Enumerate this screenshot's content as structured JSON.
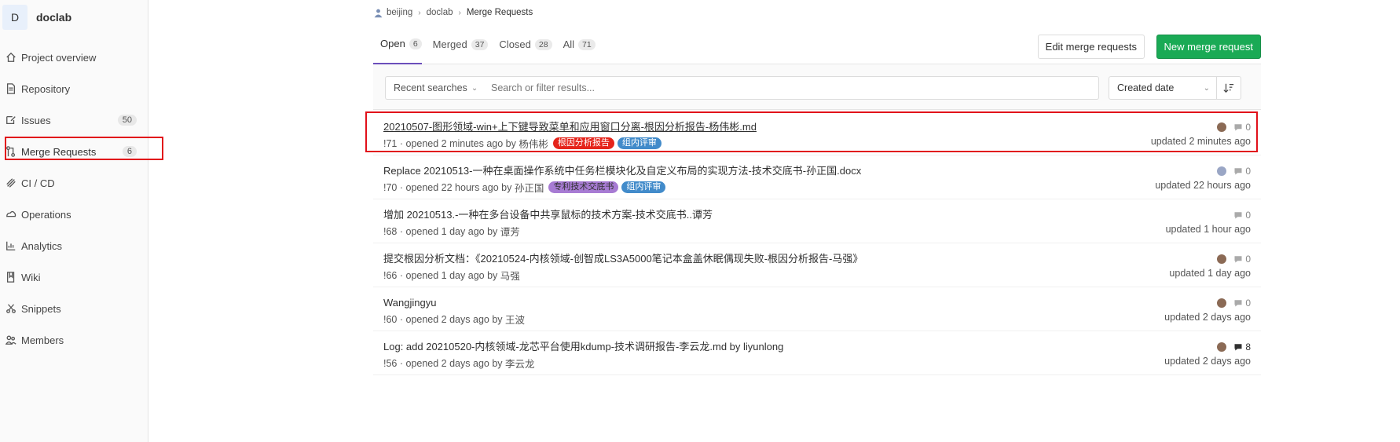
{
  "sidebar": {
    "project_initial": "D",
    "project_name": "doclab",
    "items": [
      {
        "label": "Project overview",
        "icon": "home-icon"
      },
      {
        "label": "Repository",
        "icon": "doc-icon"
      },
      {
        "label": "Issues",
        "icon": "issues-icon",
        "count": "50"
      },
      {
        "label": "Merge Requests",
        "icon": "merge-icon",
        "count": "6"
      },
      {
        "label": "CI / CD",
        "icon": "rocket-icon"
      },
      {
        "label": "Operations",
        "icon": "cloud-icon"
      },
      {
        "label": "Analytics",
        "icon": "chart-icon"
      },
      {
        "label": "Wiki",
        "icon": "book-icon"
      },
      {
        "label": "Snippets",
        "icon": "scissors-icon"
      },
      {
        "label": "Members",
        "icon": "users-icon"
      }
    ]
  },
  "breadcrumb": {
    "group": "beijing",
    "project": "doclab",
    "current": "Merge Requests"
  },
  "tabs": [
    {
      "label": "Open",
      "count": "6"
    },
    {
      "label": "Merged",
      "count": "37"
    },
    {
      "label": "Closed",
      "count": "28"
    },
    {
      "label": "All",
      "count": "71"
    }
  ],
  "actions": {
    "edit": "Edit merge requests",
    "new": "New merge request"
  },
  "filter": {
    "recent": "Recent searches",
    "placeholder": "Search or filter results...",
    "sort": "Created date"
  },
  "colors": {
    "accent": "#6b4fbb",
    "new_button": "#1aaa55",
    "highlight": "#e1101a"
  },
  "merge_requests": [
    {
      "title": "20210507-图形领域-win+上下键导致菜单和应用窗口分离-根因分析报告-杨伟彬.md",
      "ref": "!71",
      "opened": "opened 2 minutes ago by",
      "author": "杨伟彬",
      "labels": [
        {
          "text": "根因分析报告",
          "color": "#e5241b"
        },
        {
          "text": "组内评审",
          "color": "#428bca"
        }
      ],
      "comments": "0",
      "updated": "updated 2 minutes ago"
    },
    {
      "title": "Replace 20210513-一种在桌面操作系统中任务栏模块化及自定义布局的实现方法-技术交底书-孙正国.docx",
      "ref": "!70",
      "opened": "opened 22 hours ago by",
      "author": "孙正国",
      "labels": [
        {
          "text": "专利技术交底书",
          "color": "#a77bd3"
        },
        {
          "text": "组内评审",
          "color": "#428bca"
        }
      ],
      "comments": "0",
      "updated": "updated 22 hours ago"
    },
    {
      "title": "增加 20210513.-一种在多台设备中共享鼠标的技术方案-技术交底书..谭芳",
      "ref": "!68",
      "opened": "opened 1 day ago by",
      "author": "谭芳",
      "labels": [],
      "comments": "0",
      "updated": "updated 1 hour ago"
    },
    {
      "title": "提交根因分析文档：《20210524-内核领域-创智成LS3A5000笔记本盒盖休眠偶现失败-根因分析报告-马强》",
      "ref": "!66",
      "opened": "opened 1 day ago by",
      "author": "马强",
      "labels": [],
      "comments": "0",
      "updated": "updated 1 day ago"
    },
    {
      "title": "Wangjingyu",
      "ref": "!60",
      "opened": "opened 2 days ago by",
      "author": "王波",
      "labels": [],
      "comments": "0",
      "updated": "updated 2 days ago"
    },
    {
      "title": "Log: add 20210520-内核领域-龙芯平台使用kdump-技术调研报告-李云龙.md by liyunlong",
      "ref": "!56",
      "opened": "opened 2 days ago by",
      "author": "李云龙",
      "labels": [],
      "comments": "8",
      "updated": "updated 2 days ago"
    }
  ]
}
